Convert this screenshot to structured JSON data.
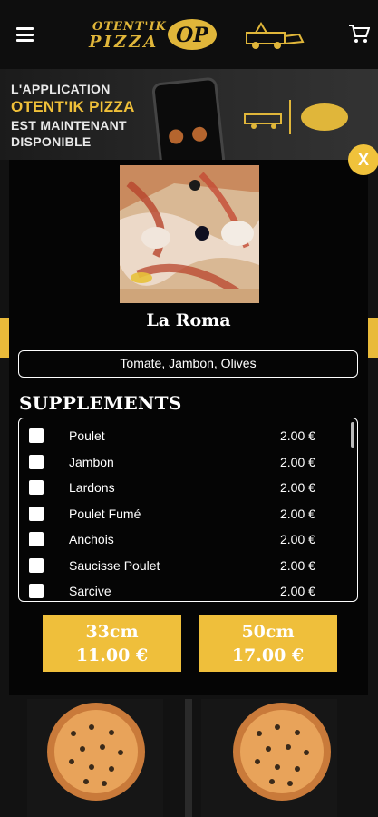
{
  "header": {
    "brand_line1": "OTENT'IK",
    "brand_line2": "PIZZA",
    "brand_mark": "OP"
  },
  "banner": {
    "line1": "L'APPLICATION",
    "line2": "OTENT'IK PIZZA",
    "line3": "EST MAINTENANT",
    "line4": "DISPONIBLE"
  },
  "modal": {
    "close_label": "X",
    "title": "La Roma",
    "ingredients": "Tomate, Jambon, Olives",
    "supplements_title": "SUPPLEMENTS",
    "supplements": [
      {
        "name": "Poulet",
        "price": "2.00 €",
        "checked": false
      },
      {
        "name": "Jambon",
        "price": "2.00 €",
        "checked": false
      },
      {
        "name": "Lardons",
        "price": "2.00 €",
        "checked": false
      },
      {
        "name": "Poulet Fumé",
        "price": "2.00 €",
        "checked": false
      },
      {
        "name": "Anchois",
        "price": "2.00 €",
        "checked": false
      },
      {
        "name": "Saucisse Poulet",
        "price": "2.00 €",
        "checked": false
      },
      {
        "name": "Sarcive",
        "price": "2.00 €",
        "checked": false
      }
    ],
    "sizes": [
      {
        "size": "33cm",
        "price": "11.00 €"
      },
      {
        "size": "50cm",
        "price": "17.00 €"
      }
    ]
  },
  "colors": {
    "accent": "#efbf3b",
    "background": "#050505"
  }
}
